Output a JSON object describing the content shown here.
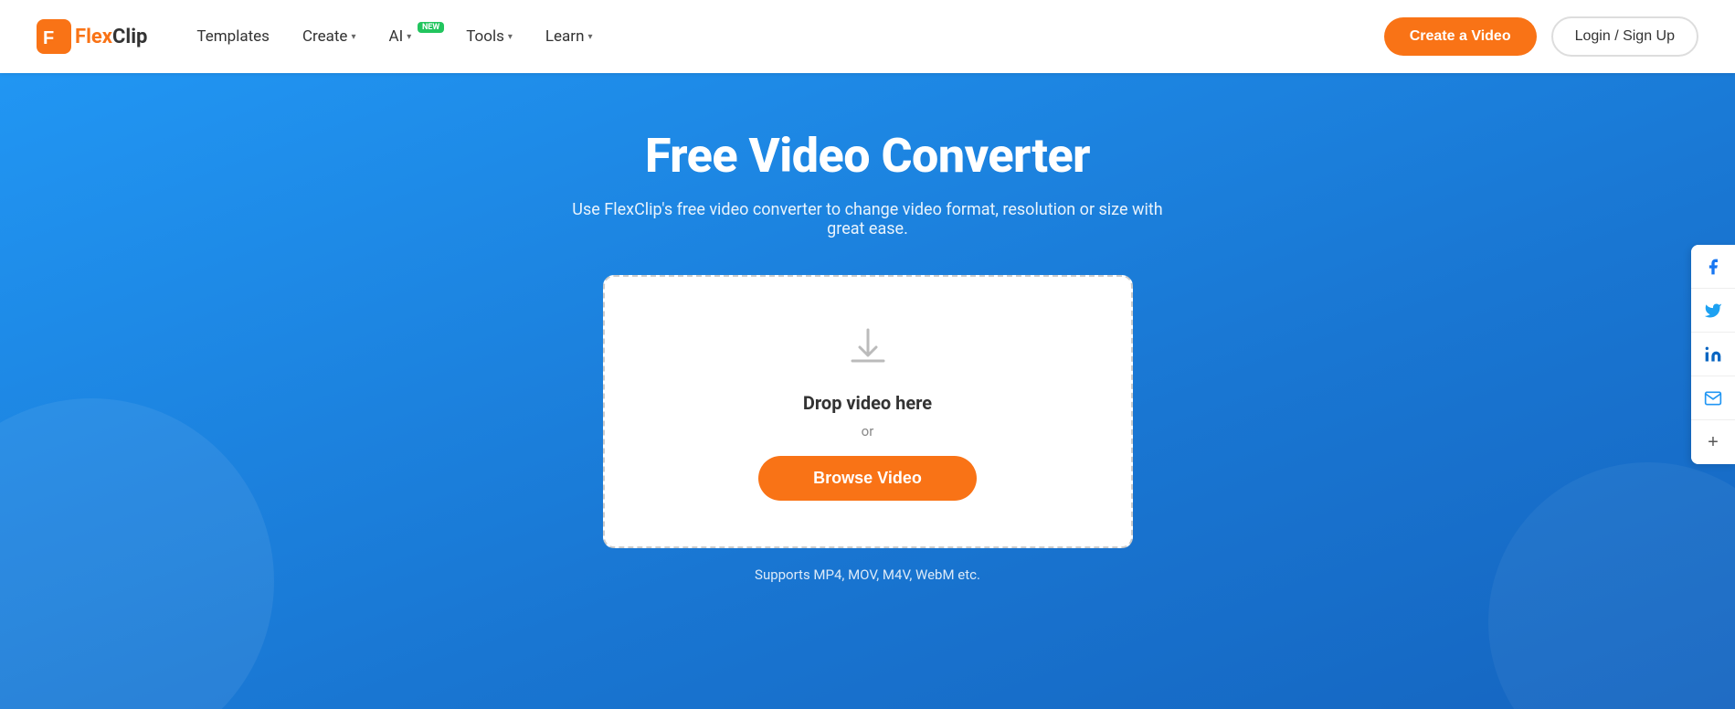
{
  "brand": {
    "name_flex": "Flex",
    "name_clip": "Clip"
  },
  "nav": {
    "templates_label": "Templates",
    "create_label": "Create",
    "ai_label": "AI",
    "ai_badge": "NEW",
    "tools_label": "Tools",
    "learn_label": "Learn",
    "create_video_label": "Create a Video",
    "login_label": "Login / Sign Up"
  },
  "hero": {
    "title": "Free Video Converter",
    "subtitle": "Use FlexClip's free video converter to change video format, resolution or size with great ease.",
    "drop_text": "Drop video here",
    "or_text": "or",
    "browse_label": "Browse Video",
    "supports_text": "Supports MP4, MOV, M4V, WebM etc."
  },
  "social": {
    "facebook_label": "f",
    "twitter_label": "🐦",
    "linkedin_label": "in",
    "email_label": "✉",
    "more_label": "+"
  }
}
